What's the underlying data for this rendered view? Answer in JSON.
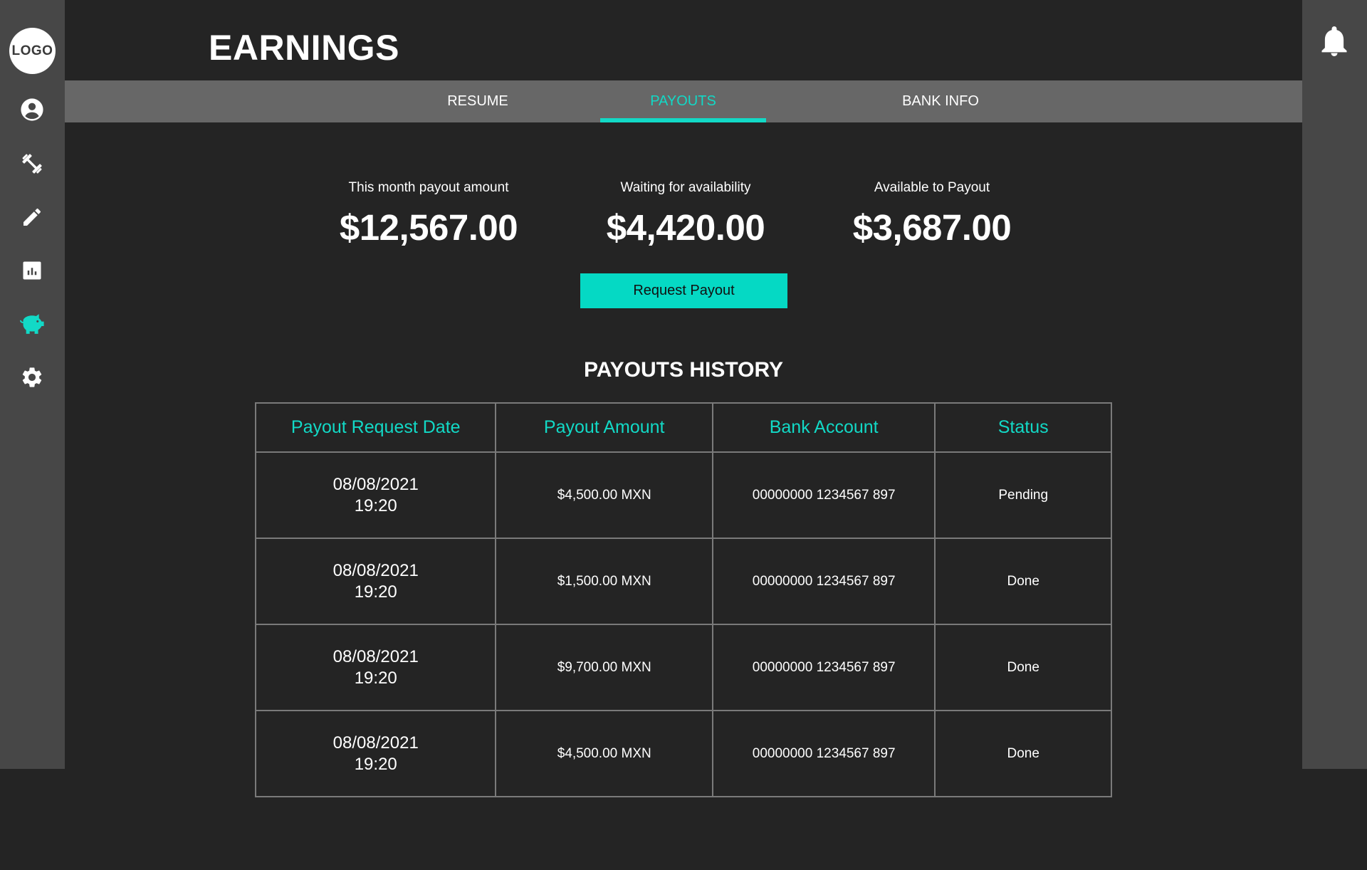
{
  "sidebar": {
    "logo_text": "LOGO",
    "items": [
      {
        "icon": "user-circle-icon"
      },
      {
        "icon": "dumbbell-icon"
      },
      {
        "icon": "pencil-icon"
      },
      {
        "icon": "bar-chart-icon"
      },
      {
        "icon": "piggy-bank-icon",
        "active": true
      },
      {
        "icon": "gear-icon"
      }
    ]
  },
  "header": {
    "title": "EARNINGS",
    "notification_icon": "bell-icon"
  },
  "tabs": [
    {
      "label": "RESUME"
    },
    {
      "label": "PAYOUTS",
      "active": true
    },
    {
      "label": "BANK INFO"
    }
  ],
  "summary": {
    "this_month": {
      "label": "This month payout amount",
      "value": "$12,567.00"
    },
    "waiting": {
      "label": "Waiting for availability",
      "value": "$4,420.00"
    },
    "available": {
      "label": "Available to Payout",
      "value": "$3,687.00"
    }
  },
  "request_button": {
    "label": "Request Payout"
  },
  "history": {
    "title": "PAYOUTS HISTORY",
    "columns": [
      "Payout Request Date",
      "Payout Amount",
      "Bank Account",
      "Status"
    ],
    "rows": [
      {
        "date": "08/08/2021",
        "time": "19:20",
        "amount": "$4,500.00 MXN",
        "account": "00000000 1234567 897",
        "status": "Pending"
      },
      {
        "date": "08/08/2021",
        "time": "19:20",
        "amount": "$1,500.00 MXN",
        "account": "00000000 1234567 897",
        "status": "Done"
      },
      {
        "date": "08/08/2021",
        "time": "19:20",
        "amount": "$9,700.00 MXN",
        "account": "00000000 1234567 897",
        "status": "Done"
      },
      {
        "date": "08/08/2021",
        "time": "19:20",
        "amount": "$4,500.00 MXN",
        "account": "00000000 1234567 897",
        "status": "Done"
      }
    ]
  },
  "colors": {
    "accent": "#12d9c6",
    "background": "#242424",
    "sidebar": "#474747",
    "tabbar": "#676767"
  }
}
